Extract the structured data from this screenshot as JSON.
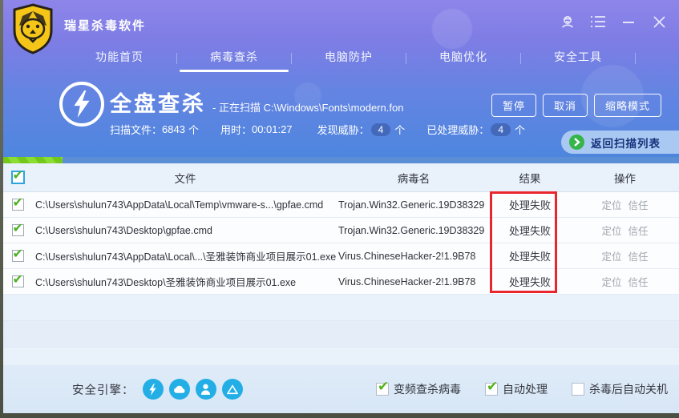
{
  "window": {
    "title": "瑞星杀毒软件",
    "icons": {
      "logo": "rising-lion-shield",
      "support": "headset-person",
      "menu": "list-menu",
      "minimize": "minimize-bar",
      "close": "close-x"
    }
  },
  "nav": {
    "tabs": [
      {
        "label": "功能首页",
        "active": false
      },
      {
        "label": "病毒查杀",
        "active": true
      },
      {
        "label": "电脑防护",
        "active": false
      },
      {
        "label": "电脑优化",
        "active": false
      },
      {
        "label": "安全工具",
        "active": false
      }
    ]
  },
  "scan": {
    "title": "全盘查杀",
    "status_prefix": "- 正在扫描",
    "scanning_path": "C:\\Windows\\Fonts\\modern.fon",
    "stats": [
      {
        "label": "扫描文件：",
        "value": "6843",
        "suffix": "个"
      },
      {
        "label": "用时：",
        "value": "00:01:27",
        "suffix": ""
      },
      {
        "label": "发现威胁：",
        "value": "4",
        "suffix": "个"
      },
      {
        "label": "已处理威胁：",
        "value": "4",
        "suffix": "个"
      }
    ],
    "buttons": {
      "pause": "暂停",
      "cancel": "取消",
      "compact": "缩略模式"
    },
    "back_button": "返回扫描列表",
    "progress_percent": 8.8
  },
  "table": {
    "headers": {
      "file": "文件",
      "virus": "病毒名",
      "result": "结果",
      "action": "操作"
    },
    "select_all_checked": true,
    "rows": [
      {
        "checked": true,
        "file": "C:\\Users\\shulun743\\AppData\\Local\\Temp\\vmware-s...\\gpfae.cmd",
        "virus": "Trojan.Win32.Generic.19D38329",
        "result": "处理失败",
        "action1": "定位",
        "action2": "信任"
      },
      {
        "checked": true,
        "file": "C:\\Users\\shulun743\\Desktop\\gpfae.cmd",
        "virus": "Trojan.Win32.Generic.19D38329",
        "result": "处理失败",
        "action1": "定位",
        "action2": "信任"
      },
      {
        "checked": true,
        "file": "C:\\Users\\shulun743\\AppData\\Local\\...\\圣雅装饰商业项目展示01.exe",
        "virus": "Virus.ChineseHacker-2!1.9B78",
        "result": "处理失败",
        "action1": "定位",
        "action2": "信任"
      },
      {
        "checked": true,
        "file": "C:\\Users\\shulun743\\Desktop\\圣雅装饰商业项目展示01.exe",
        "virus": "Virus.ChineseHacker-2!1.9B78",
        "result": "处理失败",
        "action1": "定位",
        "action2": "信任"
      }
    ],
    "annotation": {
      "shape": "red-rectangle",
      "around": "result-column"
    }
  },
  "footer": {
    "engines_label": "安全引擎：",
    "engine_icons": [
      "lightning",
      "cloud",
      "user",
      "drive-triangle"
    ],
    "checkboxes": [
      {
        "label": "变频查杀病毒",
        "checked": true
      },
      {
        "label": "自动处理",
        "checked": true
      },
      {
        "label": "杀毒后自动关机",
        "checked": false
      }
    ]
  },
  "colors": {
    "header_purple": "#8e85e9",
    "header_blue": "#4b86de",
    "progress_green": "#74c81c",
    "back_bar": "#aac9f2",
    "annotation_red": "#e9262d",
    "check_green": "#4cb122",
    "engine_cyan": "#23aee6"
  }
}
